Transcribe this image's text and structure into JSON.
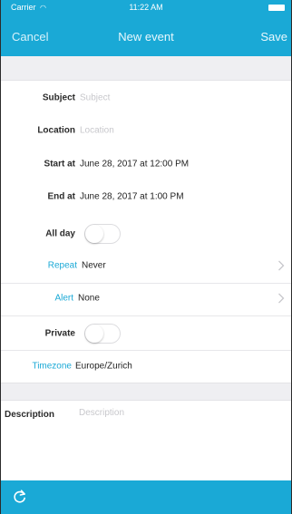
{
  "status": {
    "carrier": "Carrier",
    "wifi_icon": "wifi-icon",
    "time": "11:22 AM"
  },
  "nav": {
    "cancel_label": "Cancel",
    "title": "New event",
    "save_label": "Save"
  },
  "form": {
    "subject": {
      "label": "Subject",
      "placeholder": "Subject"
    },
    "location": {
      "label": "Location",
      "placeholder": "Location"
    },
    "start": {
      "label": "Start at",
      "value": "June 28, 2017 at 12:00 PM"
    },
    "end": {
      "label": "End at",
      "value": "June 28, 2017 at 1:00 PM"
    },
    "all_day": {
      "label": "All day",
      "on": false
    },
    "repeat": {
      "label": "Repeat",
      "value": "Never"
    },
    "alert": {
      "label": "Alert",
      "value": "None"
    },
    "private": {
      "label": "Private",
      "on": false
    },
    "timezone": {
      "label": "Timezone",
      "value": "Europe/Zurich"
    },
    "description": {
      "label": "Description",
      "placeholder": "Description"
    }
  },
  "colors": {
    "accent": "#1aa9d6",
    "section_bg": "#efeff2"
  },
  "icons": {
    "chevron": "chevron-right-icon",
    "refresh": "refresh-icon"
  }
}
